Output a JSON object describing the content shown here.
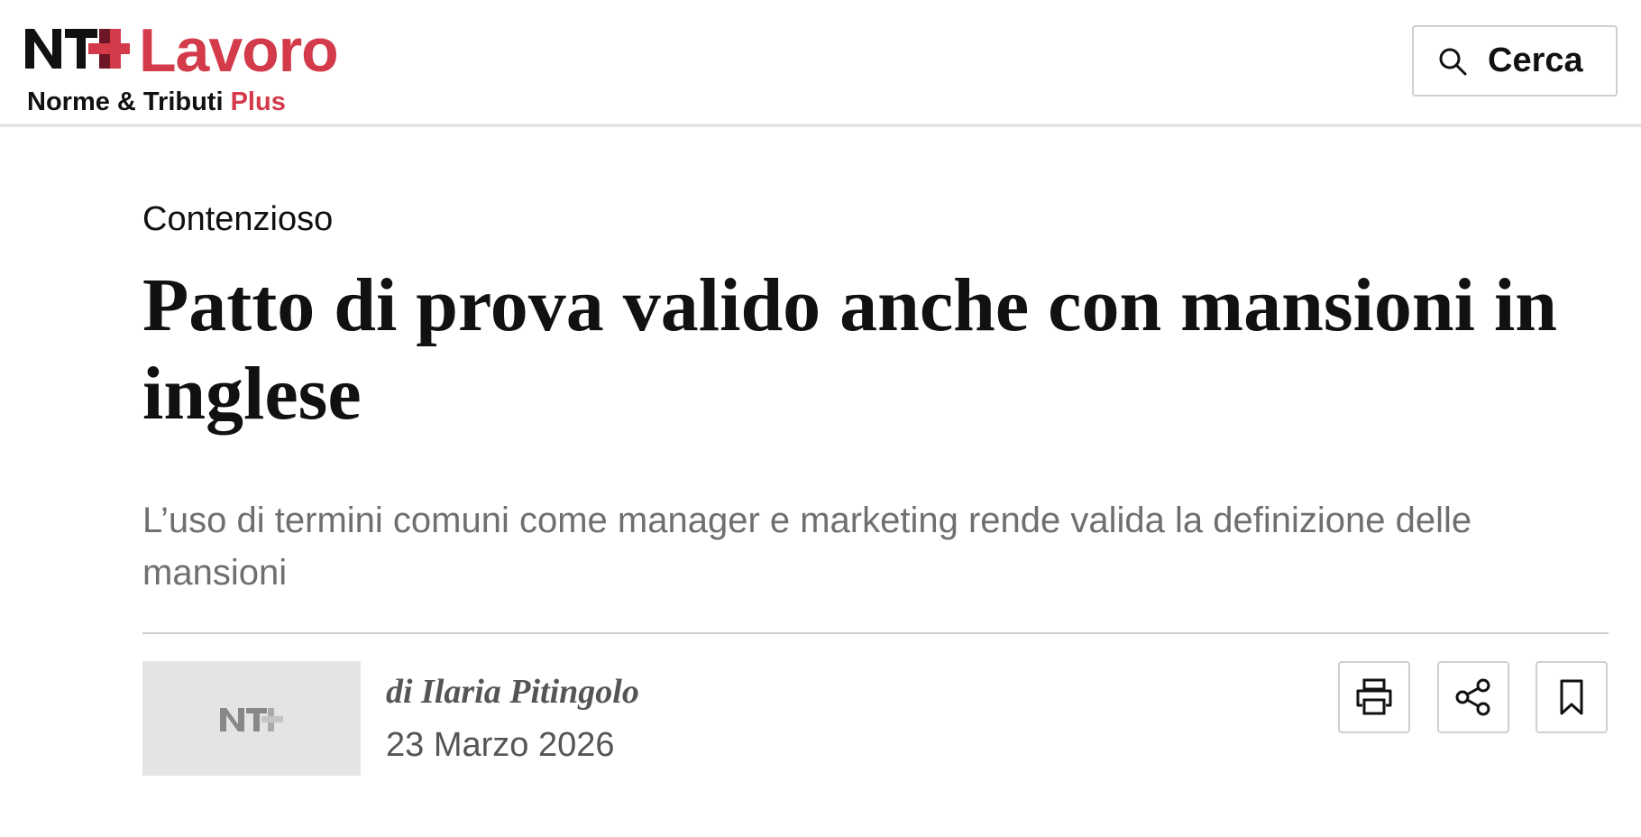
{
  "header": {
    "logo": {
      "mark": "NT+",
      "brand": "Lavoro",
      "tagline": "Norme & Tributi",
      "tagline_plus": "Plus"
    },
    "search": {
      "label": "Cerca",
      "icon": "search-icon"
    }
  },
  "article": {
    "section": "Contenzioso",
    "title": "Patto di prova valido anche con mansioni in inglese",
    "subtitle": "L’uso di termini comuni come manager e marketing rende valida la definizione delle mansioni",
    "byline": "di Ilaria Pitingolo",
    "date": "23 Marzo 2026",
    "author_thumbnail": "NT+"
  },
  "actions": {
    "print_icon": "printer-icon",
    "share_icon": "share-icon",
    "bookmark_icon": "bookmark-icon"
  },
  "colors": {
    "brand_red": "#d33a4a",
    "text": "#111111",
    "muted": "#6f6f6f",
    "border": "#cfcfcf"
  }
}
